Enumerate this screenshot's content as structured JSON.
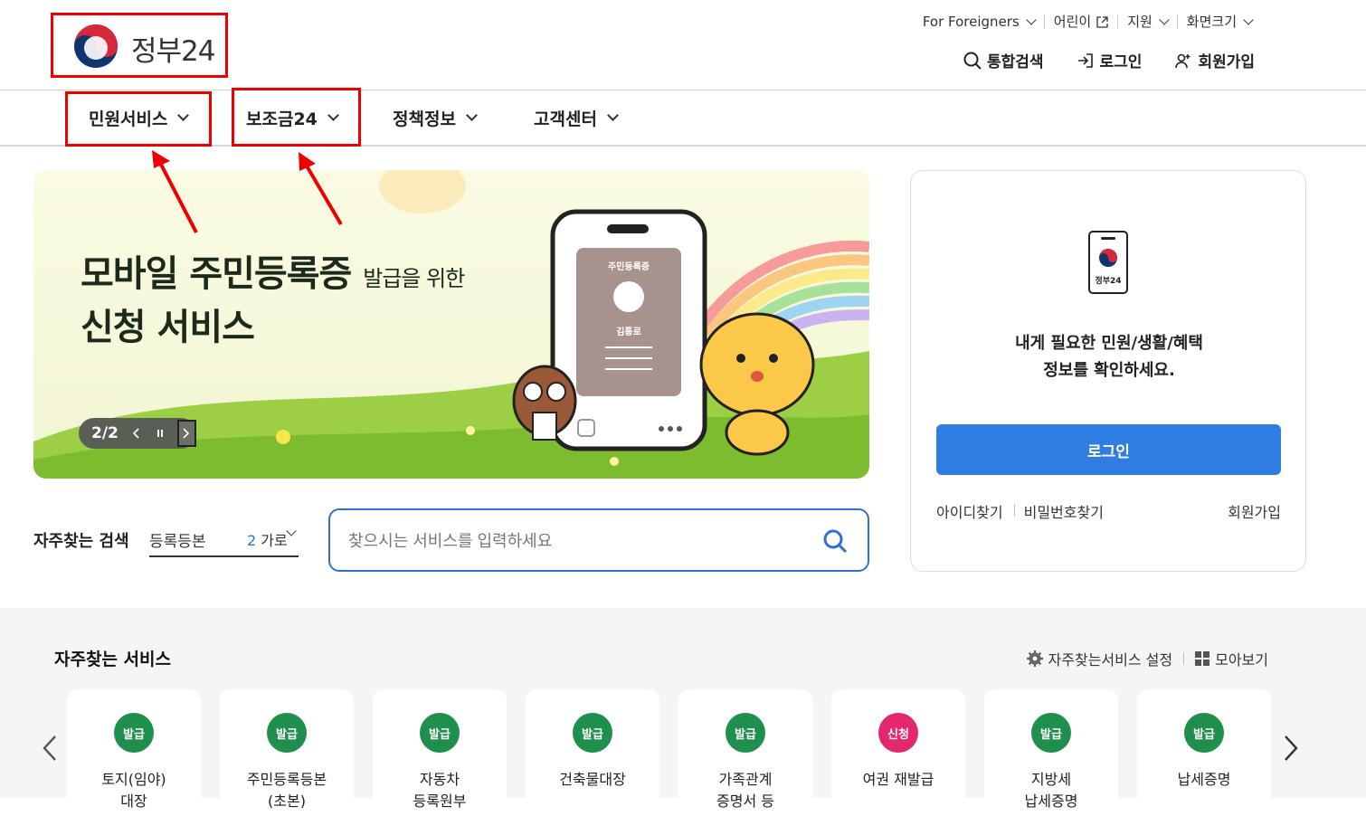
{
  "header": {
    "logo_text": "정부24",
    "util_links": [
      {
        "label": "For Foreigners"
      },
      {
        "label": "어린이"
      },
      {
        "label": "지원"
      },
      {
        "label": "화면크기"
      }
    ],
    "actions": [
      {
        "label": "통합검색",
        "icon": "search-icon"
      },
      {
        "label": "로그인",
        "icon": "login-icon"
      },
      {
        "label": "회원가입",
        "icon": "user-add-icon"
      }
    ]
  },
  "gnb": {
    "items": [
      "민원서비스",
      "보조금24",
      "정책정보",
      "고객센터"
    ]
  },
  "banner": {
    "title_line1": "모바일 주민등록증",
    "title_small": "발급을 위한",
    "title_line2": "신청 서비스",
    "phone_card_label": "주민등록증",
    "phone_card_name": "김통로",
    "pager_text": "2/2"
  },
  "login_card": {
    "phone_label": "정부24",
    "message_line1": "내게 필요한 민원/생활/혜택",
    "message_line2": "정보를 확인하세요.",
    "login_button": "로그인",
    "find_id": "아이디찾기",
    "find_pw": "비밀번호찾기",
    "signup": "회원가입"
  },
  "search": {
    "label": "자주찾는 검색",
    "term": "등록등본",
    "count_num": "2",
    "count_rest": "가로",
    "placeholder": "찾으시는 서비스를 입력하세요"
  },
  "services": {
    "title": "자주찾는 서비스",
    "settings_label": "자주찾는서비스 설정",
    "view_all_label": "모아보기",
    "colors": {
      "issue": "#1f8f4e",
      "apply": "#e5286e"
    },
    "cards": [
      {
        "badge": "발급",
        "name": "토지(임야)",
        "sub": "대장"
      },
      {
        "badge": "발급",
        "name": "주민등록등본",
        "sub": "(초본)"
      },
      {
        "badge": "발급",
        "name": "자동차",
        "sub": "등록원부"
      },
      {
        "badge": "발급",
        "name": "건축물대장",
        "sub": ""
      },
      {
        "badge": "발급",
        "name": "가족관계",
        "sub": "증명서 등"
      },
      {
        "badge": "신청",
        "name": "여권 재발급",
        "sub": ""
      },
      {
        "badge": "발급",
        "name": "지방세",
        "sub": "납세증명"
      },
      {
        "badge": "발급",
        "name": "납세증명",
        "sub": ""
      }
    ]
  }
}
